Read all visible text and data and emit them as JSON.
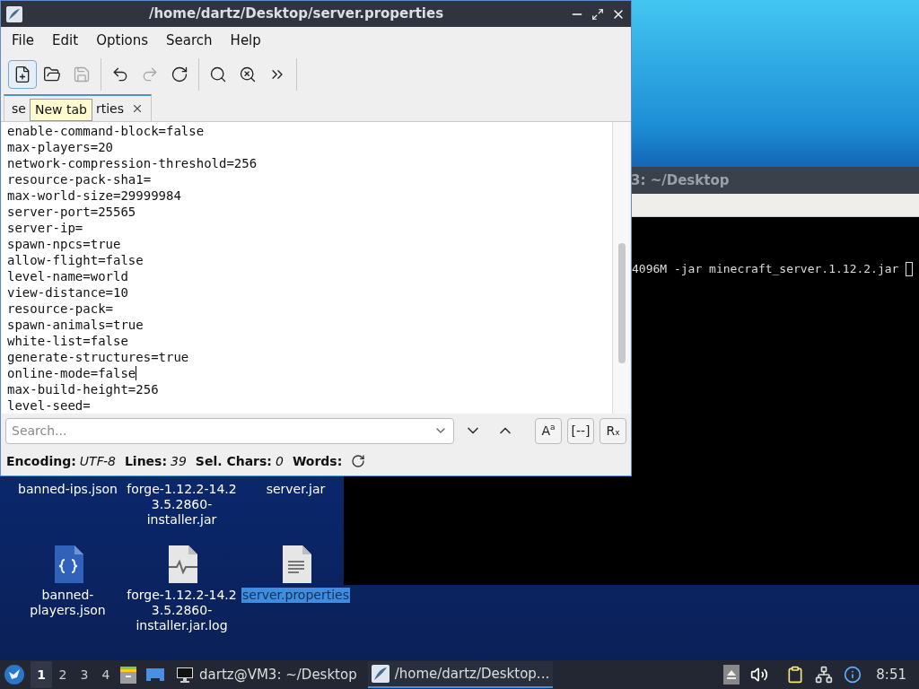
{
  "editor": {
    "title": "/home/dartz/Desktop/server.properties",
    "menu": [
      "File",
      "Edit",
      "Options",
      "Search",
      "Help"
    ],
    "toolbar": [
      {
        "kind": "new",
        "pressed": true,
        "disabled": false
      },
      {
        "kind": "open",
        "pressed": false,
        "disabled": false
      },
      {
        "kind": "save",
        "pressed": false,
        "disabled": true
      },
      {
        "kind": "sep"
      },
      {
        "kind": "undo",
        "pressed": false,
        "disabled": false
      },
      {
        "kind": "redo",
        "pressed": false,
        "disabled": true
      },
      {
        "kind": "reload",
        "pressed": false,
        "disabled": false
      },
      {
        "kind": "sep"
      },
      {
        "kind": "find",
        "pressed": false,
        "disabled": false
      },
      {
        "kind": "replace",
        "pressed": false,
        "disabled": false
      },
      {
        "kind": "more",
        "pressed": false,
        "disabled": false
      }
    ],
    "tabs": [
      {
        "label_start": "se",
        "label_end": "rties",
        "selected": true
      }
    ],
    "tooltip": "New tab",
    "lines": [
      {
        "text": "enable-command-block=false",
        "caret": false
      },
      {
        "text": "max-players=20",
        "caret": false
      },
      {
        "text": "network-compression-threshold=256",
        "caret": false
      },
      {
        "text": "resource-pack-sha1=",
        "caret": false
      },
      {
        "text": "max-world-size=29999984",
        "caret": false
      },
      {
        "text": "server-port=25565",
        "caret": false
      },
      {
        "text": "server-ip=",
        "caret": false
      },
      {
        "text": "spawn-npcs=true",
        "caret": false
      },
      {
        "text": "allow-flight=false",
        "caret": false
      },
      {
        "text": "level-name=world",
        "caret": false
      },
      {
        "text": "view-distance=10",
        "caret": false
      },
      {
        "text": "resource-pack=",
        "caret": false
      },
      {
        "text": "spawn-animals=true",
        "caret": false
      },
      {
        "text": "white-list=false",
        "caret": false
      },
      {
        "text": "generate-structures=true",
        "caret": false
      },
      {
        "text": "online-mode=false",
        "caret": true
      },
      {
        "text": "max-build-height=256",
        "caret": false
      },
      {
        "text": "level-seed=",
        "caret": false
      }
    ],
    "search": {
      "placeholder": "Search..."
    },
    "search_buttons": [
      {
        "kind": "down"
      },
      {
        "kind": "up"
      },
      {
        "kind": "case",
        "label": "A",
        "sup": "a"
      },
      {
        "kind": "whole",
        "label": "[--]"
      },
      {
        "kind": "regex",
        "label": "R",
        "sub": "x"
      }
    ],
    "status": [
      {
        "label": "Encoding:",
        "value": "UTF-8"
      },
      {
        "label": "Lines:",
        "value": "39"
      },
      {
        "label": "Sel. Chars:",
        "value": "0"
      },
      {
        "label": "Words:"
      }
    ]
  },
  "terminal": {
    "title": "3: ~/Desktop",
    "line": "4096M -jar minecraft_server.1.12.2.jar"
  },
  "desktop_icons": [
    {
      "label": "banned-ips.json",
      "kind": "hidden",
      "selected": false
    },
    {
      "label": "forge-1.12.2-14.2 3.5.2860- installer.jar",
      "kind": "hidden",
      "selected": false
    },
    {
      "label": "server.jar",
      "kind": "hidden",
      "selected": false
    },
    {
      "label": "banned- players.json",
      "kind": "json",
      "selected": false
    },
    {
      "label": "forge-1.12.2-14.2 3.5.2860- installer.jar.log",
      "kind": "log",
      "selected": false
    },
    {
      "label": "server.properties",
      "kind": "text",
      "selected": true
    }
  ],
  "taskbar": {
    "workspaces": [
      {
        "label": "1",
        "selected": true
      },
      {
        "label": "2",
        "selected": false
      },
      {
        "label": "3",
        "selected": false
      },
      {
        "label": "4",
        "selected": false
      }
    ],
    "tasks": [
      {
        "label": "dartz@VM3: ~/Desktop",
        "kind": "terminal",
        "selected": false
      },
      {
        "label": "/home/dartz/Desktop...",
        "kind": "editor",
        "selected": true
      }
    ],
    "clock": "8:51"
  }
}
